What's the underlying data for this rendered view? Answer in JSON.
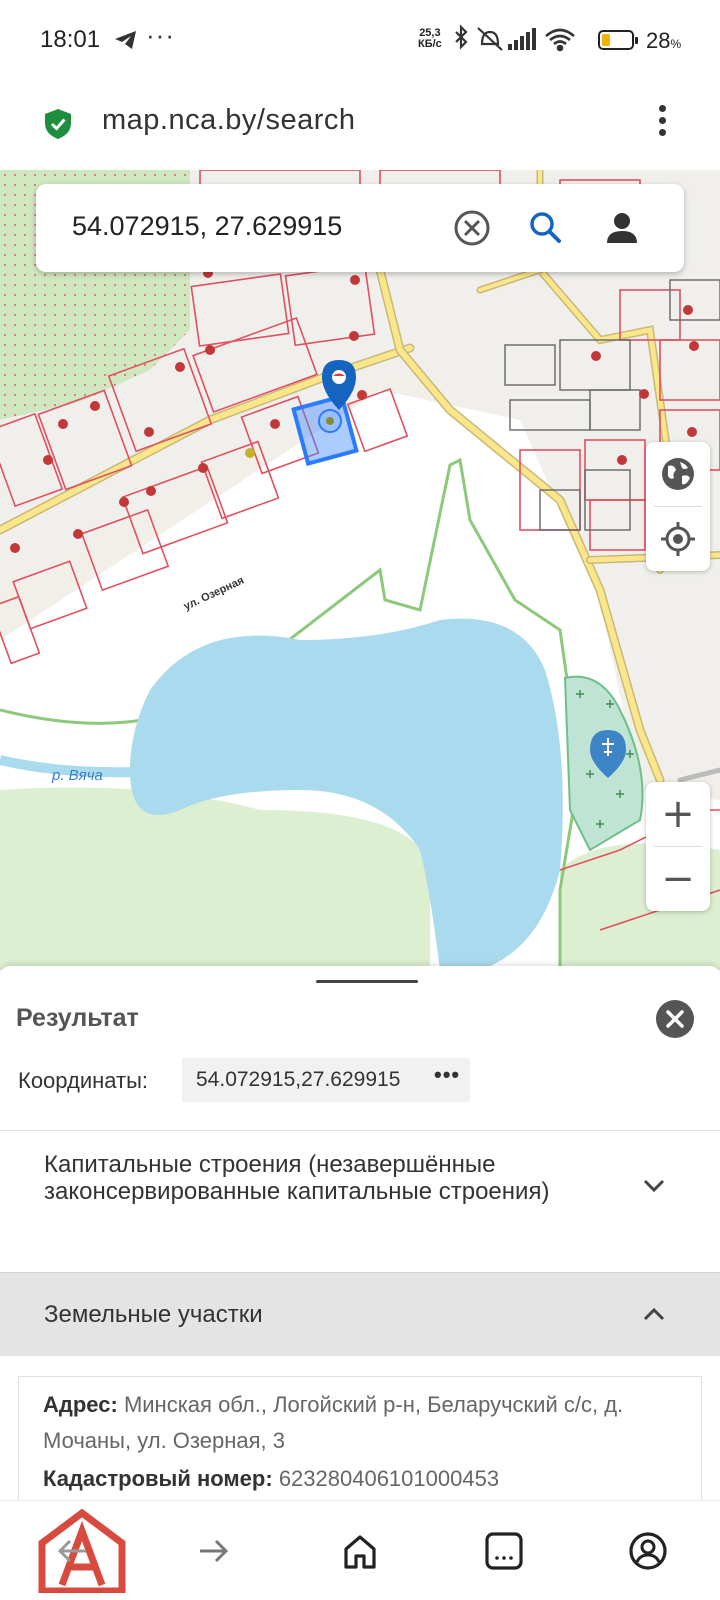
{
  "status_bar": {
    "time": "18:01",
    "net_speed_value": "25,3",
    "net_speed_unit": "КБ/с",
    "battery_percent": "28",
    "battery_unit": "%",
    "battery_level": 0.28
  },
  "browser": {
    "url": "map.nca.by/search"
  },
  "map": {
    "search_value": "54.072915, 27.629915",
    "street_label": "ул. Озерная",
    "river_label": "р. Вяча",
    "zoom_in": "+",
    "zoom_out": "−"
  },
  "results": {
    "title": "Результат",
    "coords_label": "Координаты:",
    "coords_value": "54.072915,27.629915",
    "coords_more": "•••",
    "section_capital": "Капитальные строения (незавершённые законсервированные капитальные строения)",
    "section_land": "Земельные участки",
    "address_label": "Адрес:",
    "address_value": "Минская обл., Логойский р-н, Беларучский с/с, д. Мочаны, ул. Озерная, 3",
    "cadastral_label": "Кадастровый номер:",
    "cadastral_value": "623280406101000453"
  },
  "colors": {
    "accent_blue": "#1565c0",
    "water": "#aadaee",
    "forest": "#dcefd0",
    "parcel_border": "#e05060",
    "logo_red": "#d84a3e"
  }
}
